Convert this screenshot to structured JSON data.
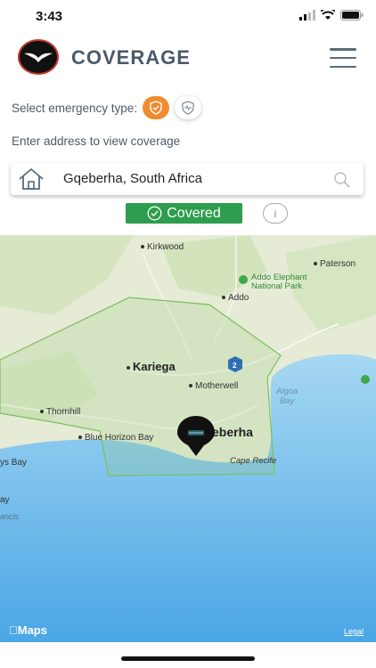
{
  "status_bar": {
    "time": "3:43"
  },
  "header": {
    "title": "COVERAGE"
  },
  "emergency": {
    "label": "Select emergency type:"
  },
  "address": {
    "label": "Enter address to view coverage",
    "value": "Gqeberha, South Africa"
  },
  "coverage": {
    "status": "Covered",
    "info_label": "i"
  },
  "map": {
    "places": {
      "kirkwood": "Kirkwood",
      "paterson": "Paterson",
      "addo_elephant": "Addo Elephant",
      "national_park": "National Park",
      "addo": "Addo",
      "kariega": "Kariega",
      "motherwell": "Motherwell",
      "algoa": "Algoa",
      "bay": "Bay",
      "thornhill": "Thornhill",
      "blue_horizon_bay": "Blue Horizon Bay",
      "gqeberha": "eberha",
      "cape_recife": "Cape Recife",
      "jeffreys_bay": "ys Bay",
      "ay": "ay",
      "ancis": "ancis",
      "route_badge": "2"
    },
    "attribution": "Maps",
    "legal": "Legal"
  },
  "colors": {
    "accent": "#f08b2f",
    "covered": "#2e9d4e",
    "land": "#e8ecd9",
    "sea": "#7dc3ec"
  }
}
